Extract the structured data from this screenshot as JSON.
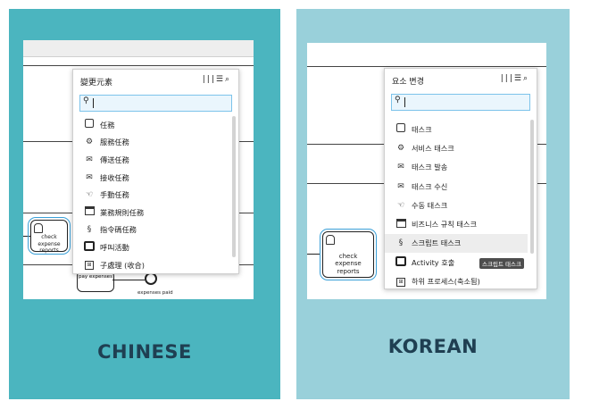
{
  "left": {
    "caption": "CHINESE",
    "popup_title": "變更元素",
    "task_label": "check expense reports",
    "shape_pay_label": "pay expenses",
    "shape_paid_label": "expenses paid",
    "items": [
      {
        "label": "任務",
        "icon": "task-icon"
      },
      {
        "label": "服務任務",
        "icon": "gear-icon"
      },
      {
        "label": "傳送任務",
        "icon": "envelope-filled-icon"
      },
      {
        "label": "接收任務",
        "icon": "envelope-icon"
      },
      {
        "label": "手動任務",
        "icon": "hand-icon"
      },
      {
        "label": "業務規則任務",
        "icon": "table-icon"
      },
      {
        "label": "指令碼任務",
        "icon": "script-icon"
      },
      {
        "label": "呼叫活動",
        "icon": "call-activity-icon"
      },
      {
        "label": "子處理 (收合)",
        "icon": "subprocess-icon"
      }
    ]
  },
  "right": {
    "caption": "KOREAN",
    "popup_title": "요소 변경",
    "task_label": "check expense reports",
    "tooltip": "스크립트 태스크",
    "items": [
      {
        "label": "태스크",
        "icon": "task-icon"
      },
      {
        "label": "서비스 태스크",
        "icon": "gear-icon"
      },
      {
        "label": "태스크 발송",
        "icon": "envelope-filled-icon"
      },
      {
        "label": "태스크 수신",
        "icon": "envelope-icon"
      },
      {
        "label": "수동 태스크",
        "icon": "hand-icon"
      },
      {
        "label": "비즈니스 규칙 태스크",
        "icon": "table-icon"
      },
      {
        "label": "스크립트 태스크",
        "icon": "script-icon"
      },
      {
        "label": "Activity 호출",
        "icon": "call-activity-icon"
      },
      {
        "label": "하위 프로세스(축소됨)",
        "icon": "subprocess-icon"
      }
    ]
  },
  "toolbar_icons": [
    "columns-icon",
    "list-icon",
    "search-icon"
  ]
}
